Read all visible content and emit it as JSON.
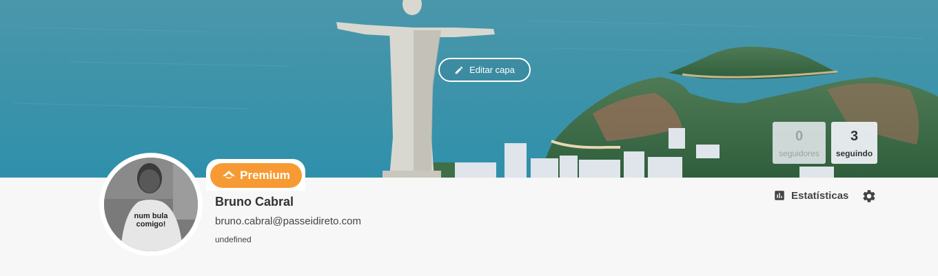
{
  "cover": {
    "edit_label": "Editar capa"
  },
  "stats": {
    "followers": {
      "count": "0",
      "label": "seguidores"
    },
    "following": {
      "count": "3",
      "label": "seguindo"
    }
  },
  "badge": {
    "label": "Premium"
  },
  "avatar": {
    "shirt_text": [
      "num bula",
      "comigo!"
    ]
  },
  "profile": {
    "name": "Bruno Cabral",
    "email": "bruno.cabral@passeidireto.com",
    "extra": "undefined"
  },
  "actions": {
    "statistics_label": "Estatísticas"
  },
  "colors": {
    "premium": "#f79a33",
    "sea": "#3a92a9",
    "text": "#333333"
  },
  "icons": [
    "pencil-icon",
    "premium-logo-icon",
    "bar-chart-icon",
    "gear-icon"
  ]
}
